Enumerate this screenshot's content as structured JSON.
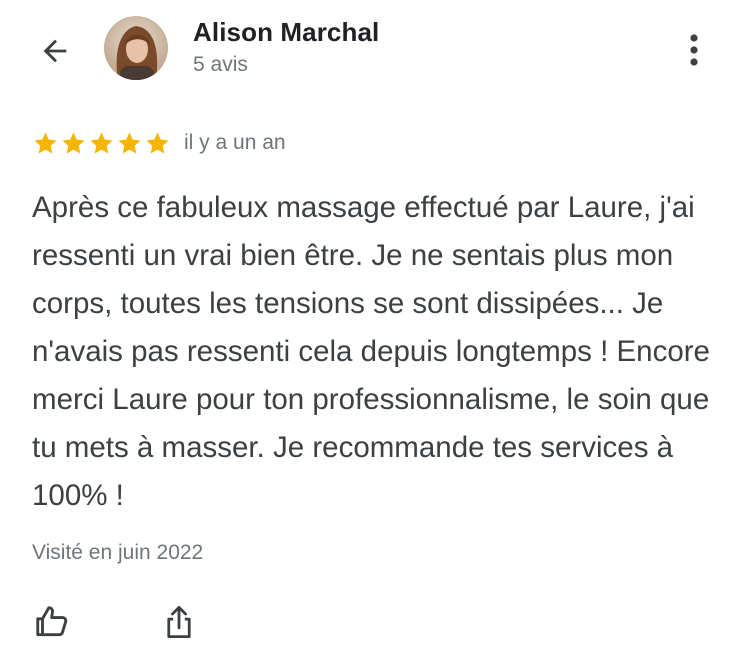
{
  "header": {
    "back_icon": "arrow-left-icon",
    "reviewer_name": "Alison Marchal",
    "review_count": "5 avis",
    "more_icon": "more-vertical-icon"
  },
  "review": {
    "rating": 5,
    "rating_max": 5,
    "star_color": "#f4b400",
    "date": "il y a un an",
    "text": "Après ce fabuleux massage effectué par Laure, j'ai ressenti un vrai bien être. Je ne sentais plus mon corps, toutes les tensions se sont dissipées... Je n'avais pas ressenti cela depuis longtemps ! Encore merci Laure pour ton professionnalisme, le soin que tu mets à masser. Je recommande tes services à 100% !",
    "visit": "Visité en juin 2022"
  },
  "actions": {
    "like_icon": "thumbs-up-icon",
    "share_icon": "share-icon"
  }
}
